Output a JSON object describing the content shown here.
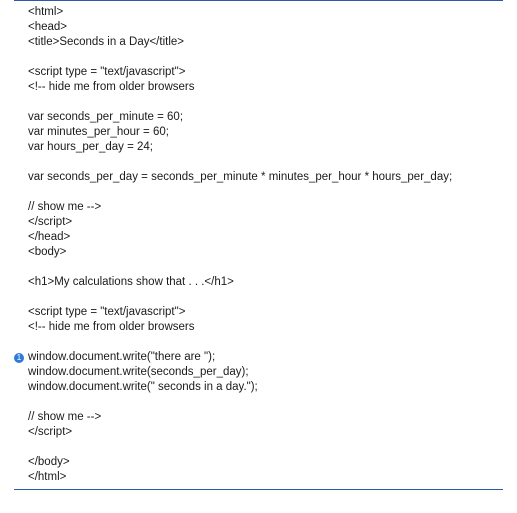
{
  "lines": [
    {
      "text": "<html>"
    },
    {
      "text": "<head>"
    },
    {
      "text": "<title>Seconds in a Day</title>"
    },
    {
      "text": ""
    },
    {
      "text": "<script type = \"text/javascript\">"
    },
    {
      "text": "<!-- hide me from older browsers"
    },
    {
      "text": ""
    },
    {
      "text": "var seconds_per_minute = 60;"
    },
    {
      "text": "var minutes_per_hour = 60;"
    },
    {
      "text": "var hours_per_day = 24;"
    },
    {
      "text": ""
    },
    {
      "text": "var seconds_per_day = seconds_per_minute * minutes_per_hour * hours_per_day;"
    },
    {
      "text": ""
    },
    {
      "text": "// show me -->"
    },
    {
      "text": "</script>"
    },
    {
      "text": "</head>"
    },
    {
      "text": "<body>"
    },
    {
      "text": ""
    },
    {
      "text": "<h1>My calculations show that . . .</h1>"
    },
    {
      "text": ""
    },
    {
      "text": "<script type = \"text/javascript\">"
    },
    {
      "text": "<!-- hide me from older browsers"
    },
    {
      "text": ""
    },
    {
      "text": "window.document.write(\"there are \");",
      "callout": "1"
    },
    {
      "text": "window.document.write(seconds_per_day);"
    },
    {
      "text": "window.document.write(\" seconds in a day.\");"
    },
    {
      "text": ""
    },
    {
      "text": "// show me -->"
    },
    {
      "text": "</script>"
    },
    {
      "text": ""
    },
    {
      "text": "</body>"
    },
    {
      "text": "</html>"
    }
  ]
}
